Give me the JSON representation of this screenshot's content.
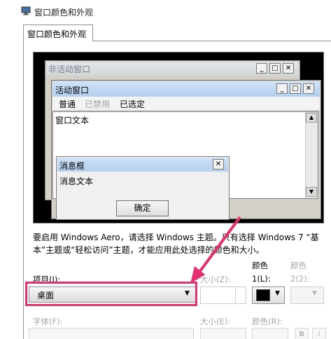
{
  "window": {
    "title": "窗口颜色和外观"
  },
  "tab": {
    "label": "窗口颜色和外观"
  },
  "preview": {
    "inactive_title": "非活动窗口",
    "active_title": "活动窗口",
    "menu": {
      "normal": "普通",
      "disabled": "已禁用",
      "selected": "已选定"
    },
    "window_text": "窗口文本",
    "message_box": {
      "title": "消息框",
      "text": "消息文本",
      "ok": "确定"
    },
    "caption_buttons": {
      "minimize": "_",
      "maximize": "□",
      "close": "✕"
    }
  },
  "description": "要启用 Windows Aero，请选择 Windows 主题。只有选择 Windows 7 “基本”主题或“轻松访问”主题，才能应用此处选择的颜色和大小。",
  "controls": {
    "item_label": "项目(I):",
    "item_value": "桌面",
    "size_label": "大小(Z):",
    "color1_label_a": "颜色",
    "color1_label_b": "1(L):",
    "color2_label_a": "颜色",
    "color2_label_b": "2(2):",
    "font_label": "字体(F):",
    "font_size_label": "大小(E):",
    "font_color_label": "颜色(R):",
    "bold": "B",
    "italic": "I"
  },
  "colors": {
    "highlight": "#e3306f",
    "color1": "#000000"
  },
  "icons": {
    "window_icon": "display-settings-icon",
    "dropdown": "chevron-down-icon"
  }
}
